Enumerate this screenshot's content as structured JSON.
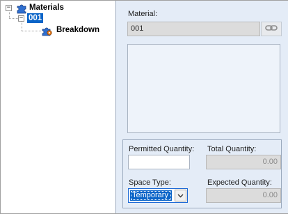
{
  "tree": {
    "root": {
      "label": "Materials",
      "expander": "−",
      "icon": "puzzle-icon"
    },
    "child": {
      "label": "001",
      "expander": "−",
      "icon": "puzzle-icon"
    },
    "grandchild": {
      "label": "Breakdown",
      "icon": "gear-puzzle-icon"
    }
  },
  "details": {
    "material_label": "Material:",
    "material_value": "001",
    "link_icon": "link-icon",
    "permitted_quantity_label": "Permitted Quantity:",
    "permitted_quantity_value": "",
    "total_quantity_label": "Total Quantity:",
    "total_quantity_value": "0.00",
    "space_type_label": "Space Type:",
    "space_type_value": "Temporary",
    "expected_quantity_label": "Expected Quantity:",
    "expected_quantity_value": "0.00"
  },
  "colors": {
    "selection": "#0a64c8",
    "pane_background": "#e4ecf7",
    "disabled_field": "#dcdcdc"
  }
}
